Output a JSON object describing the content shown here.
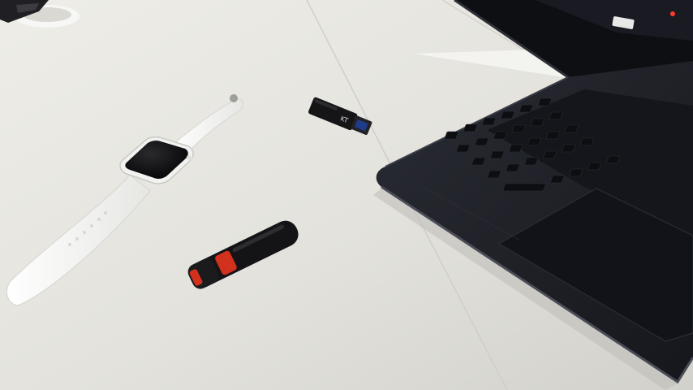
{
  "scene": {
    "description_type": "photo",
    "colors": {
      "desk": "#e6e5e0",
      "desk_shadow": "#c9c8c3",
      "laptop_body": "#1c1e25",
      "laptop_edge": "#3a3d47",
      "keycap": "#111217",
      "trackpad": "#15161c",
      "watch_band": "#f4f4f2",
      "watch_screen": "#0b0b0d",
      "usb_black": "#141416",
      "usb_red": "#d2311e",
      "usb_connector": "#1f3c8a"
    },
    "objects": [
      {
        "name": "smartwatch",
        "icon": "watch-icon"
      },
      {
        "name": "usb-flash-drive-black",
        "icon": "usb-icon",
        "printed_label": "KT"
      },
      {
        "name": "usb-flash-drive-sandisk",
        "icon": "usb-icon"
      },
      {
        "name": "laptop",
        "icon": "laptop-icon"
      },
      {
        "name": "grommet-desk-hole",
        "icon": "circle-icon"
      }
    ]
  }
}
